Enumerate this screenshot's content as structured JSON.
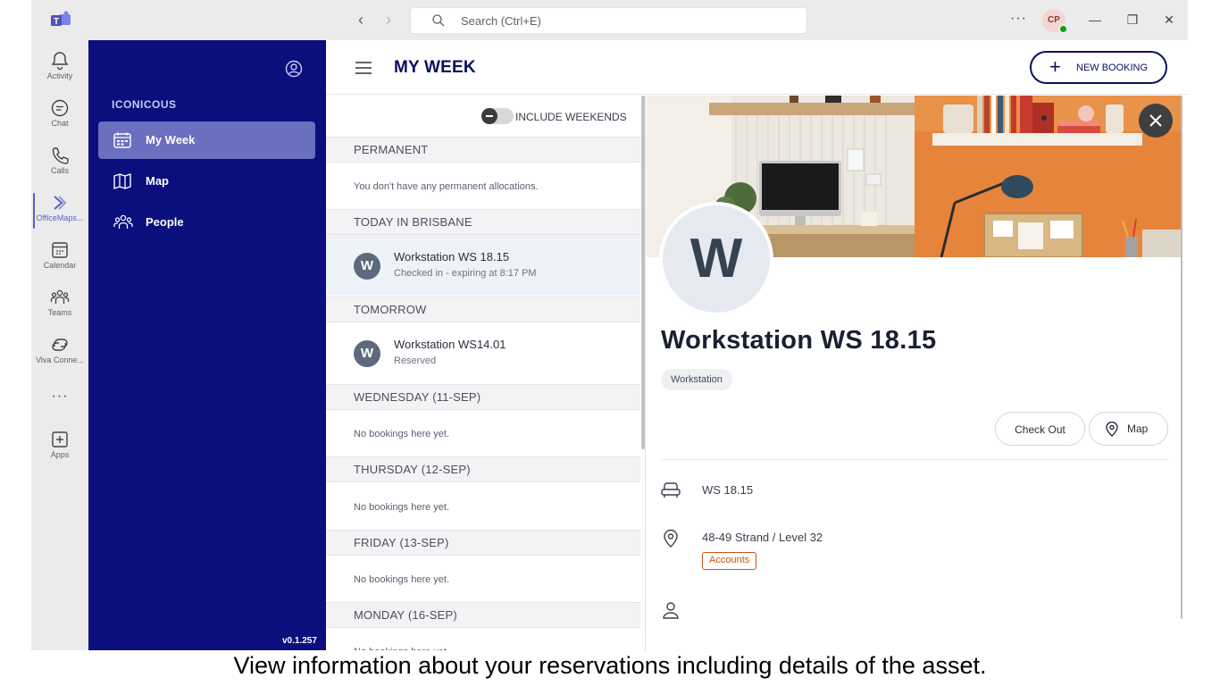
{
  "titlebar": {
    "search_placeholder": "Search (Ctrl+E)",
    "more": "···",
    "user_initials": "CP",
    "minimize": "—",
    "maximize": "❐",
    "close": "✕",
    "back": "‹",
    "forward": "›"
  },
  "appbar": {
    "items": [
      {
        "label": "Activity",
        "icon": "bell-icon"
      },
      {
        "label": "Chat",
        "icon": "chat-icon"
      },
      {
        "label": "Calls",
        "icon": "phone-icon"
      },
      {
        "label": "OfficeMaps...",
        "icon": "officemaps-icon",
        "active": true
      },
      {
        "label": "Calendar",
        "icon": "calendar-icon"
      },
      {
        "label": "Teams",
        "icon": "teams-icon"
      },
      {
        "label": "Viva Conne...",
        "icon": "viva-icon"
      },
      {
        "label": "Apps",
        "icon": "apps-plus-icon"
      }
    ],
    "more": "···"
  },
  "sidebar": {
    "org": "ICONICOUS",
    "items": [
      {
        "label": "My Week",
        "icon": "calendar-week-icon",
        "active": true
      },
      {
        "label": "Map",
        "icon": "map-icon"
      },
      {
        "label": "People",
        "icon": "people-icon"
      }
    ],
    "version": "v0.1.257"
  },
  "header": {
    "title": "MY WEEK",
    "new_booking_plus": "+",
    "new_booking": "NEW BOOKING"
  },
  "list": {
    "toggle_label": "INCLUDE WEEKENDS",
    "sections": {
      "permanent": "PERMANENT",
      "permanent_empty": "You don't have any permanent allocations.",
      "today": "TODAY IN BRISBANE",
      "tomorrow": "TOMORROW",
      "wednesday": "WEDNESDAY (11-SEP)",
      "thursday": "THURSDAY (12-SEP)",
      "friday": "FRIDAY (13-SEP)",
      "monday": "MONDAY (16-SEP)",
      "no_bookings": "No bookings here yet."
    },
    "bookings": [
      {
        "initial": "W",
        "name": "Workstation WS 18.15",
        "status": "Checked in - expiring at 8:17 PM"
      },
      {
        "initial": "W",
        "name": "Workstation WS14.01",
        "status": "Reserved"
      }
    ]
  },
  "detail": {
    "initial": "W",
    "title": "Workstation WS 18.15",
    "type_chip": "Workstation",
    "check_out": "Check Out",
    "map": "Map",
    "asset_id": "WS 18.15",
    "location": "48-49 Strand / Level 32",
    "department": "Accounts"
  },
  "caption": "View information about your reservations including details of the asset.",
  "colors": {
    "navy": "#0a0f7d",
    "active_nav": "#6a6fbf",
    "accent": "#0a0f5c",
    "dept_tag": "#c8541b"
  }
}
